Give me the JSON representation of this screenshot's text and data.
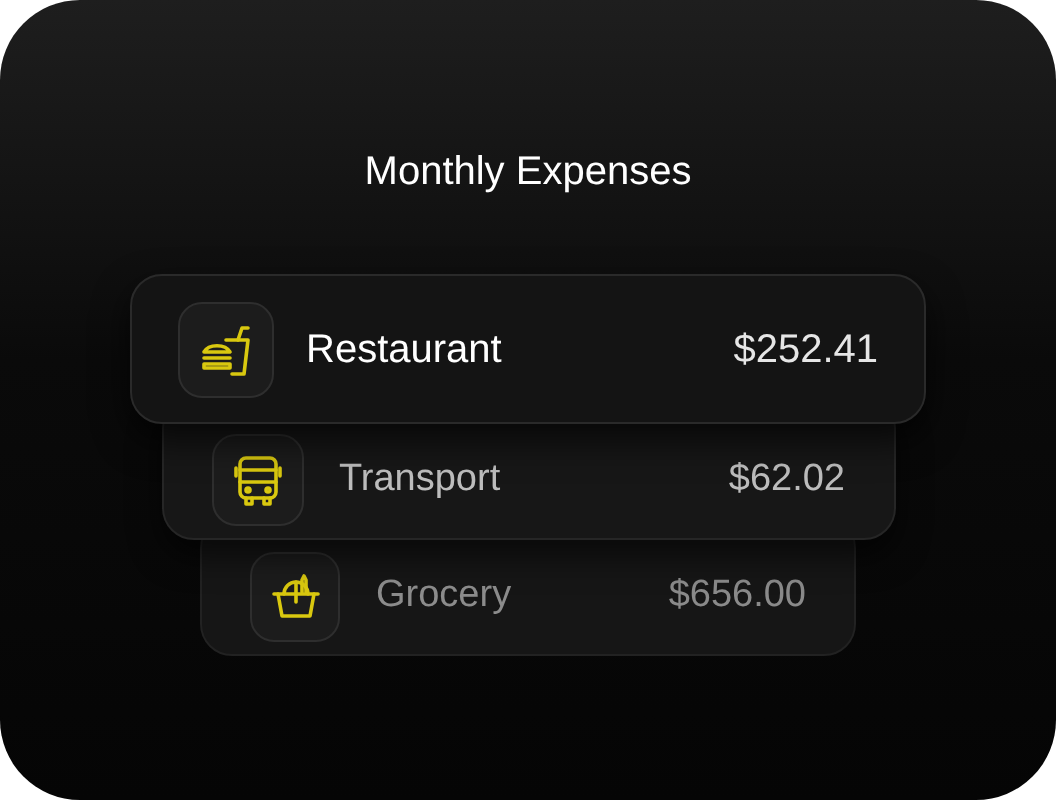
{
  "title": "Monthly Expenses",
  "expenses": [
    {
      "kind": "restaurant",
      "name": "Restaurant",
      "amount": "$252.41"
    },
    {
      "kind": "transport",
      "name": "Transport",
      "amount": "$62.02"
    },
    {
      "kind": "grocery",
      "name": "Grocery",
      "amount": "$656.00"
    }
  ]
}
